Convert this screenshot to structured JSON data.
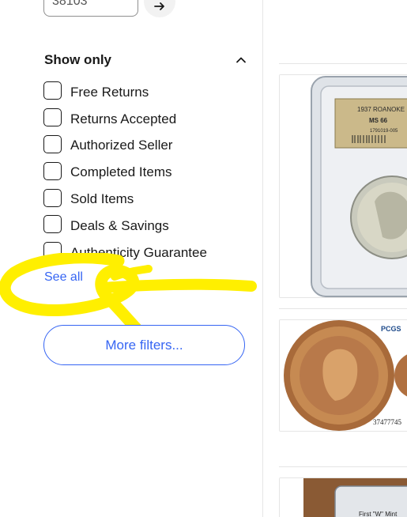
{
  "location": {
    "zip_value": "38103",
    "go_icon": "arrow-right-icon"
  },
  "show_only": {
    "title": "Show only",
    "toggle_icon": "chevron-up-icon",
    "options": [
      {
        "label": "Free Returns",
        "checked": false
      },
      {
        "label": "Returns Accepted",
        "checked": false
      },
      {
        "label": "Authorized Seller",
        "checked": false
      },
      {
        "label": "Completed Items",
        "checked": false
      },
      {
        "label": "Sold Items",
        "checked": false
      },
      {
        "label": "Deals & Savings",
        "checked": false
      },
      {
        "label": "Authenticity Guarantee",
        "checked": false
      }
    ],
    "see_all_label": "See all"
  },
  "more_filters_label": "More filters...",
  "annotation_color": "#ffef00",
  "accent_color": "#3665f3",
  "results": [
    {
      "label_line1": "1937 ROANOKE",
      "label_line2": "MS 66",
      "cert": "1791019-005"
    },
    {
      "brand": "PCGS",
      "cert": "37477745"
    },
    {
      "label_text": "First \"W\" Mint"
    }
  ]
}
